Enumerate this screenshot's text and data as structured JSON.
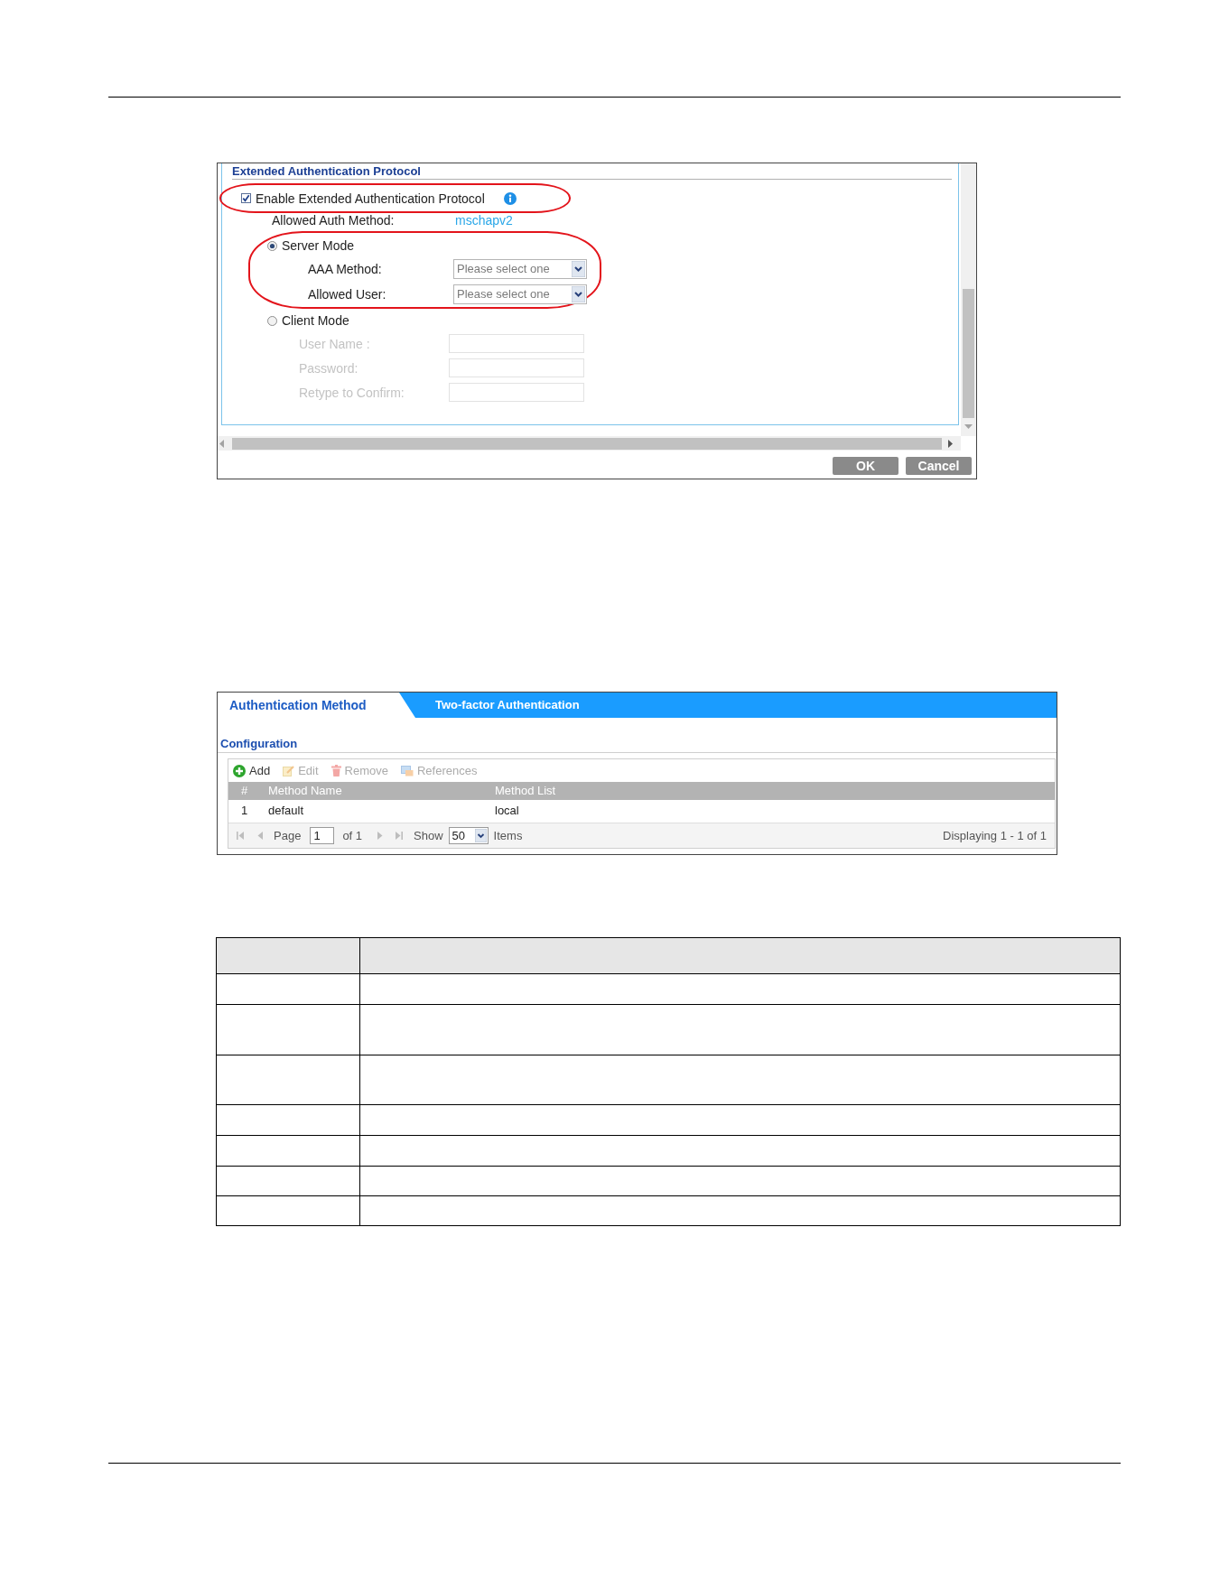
{
  "eap_panel": {
    "title": "Extended Authentication Protocol",
    "enable": {
      "label": "Enable Extended Authentication Protocol",
      "checked": true,
      "highlighted": true
    },
    "allowed_auth_method": {
      "label": "Allowed Auth Method:",
      "value": "mschapv2"
    },
    "modes": [
      {
        "label": "Server Mode",
        "selected": true,
        "highlighted": true,
        "fields": [
          {
            "kind": "select",
            "label": "AAA Method:",
            "value": "Please select one",
            "disabled": false
          },
          {
            "kind": "select",
            "label": "Allowed User:",
            "value": "Please select one",
            "disabled": false
          }
        ]
      },
      {
        "label": "Client Mode",
        "selected": false,
        "highlighted": false,
        "fields": [
          {
            "kind": "text",
            "label": "User Name :",
            "disabled": true
          },
          {
            "kind": "text",
            "label": "Password:",
            "disabled": true
          },
          {
            "kind": "text",
            "label": "Retype to Confirm:",
            "disabled": true
          }
        ]
      }
    ],
    "buttons": [
      "OK",
      "Cancel"
    ]
  },
  "auth_panel": {
    "tabs": [
      {
        "label": "Authentication Method",
        "selected": true
      },
      {
        "label": "Two-factor Authentication",
        "selected": false
      }
    ],
    "section_title": "Configuration",
    "toolbar": [
      {
        "kind": "add",
        "label": "Add",
        "disabled": false
      },
      {
        "kind": "edit",
        "label": "Edit",
        "disabled": true
      },
      {
        "kind": "remove",
        "label": "Remove",
        "disabled": true
      },
      {
        "kind": "references",
        "label": "References",
        "disabled": true
      }
    ],
    "table": {
      "columns": [
        "#",
        "Method Name",
        "Method List"
      ],
      "rows": [
        [
          "1",
          "default",
          "local"
        ]
      ]
    },
    "pager": {
      "page_label": "Page",
      "page": "1",
      "total": "of 1",
      "show_label": "Show",
      "page_size": "50",
      "items_label": "Items",
      "summary": "Displaying 1 - 1 of 1"
    }
  }
}
